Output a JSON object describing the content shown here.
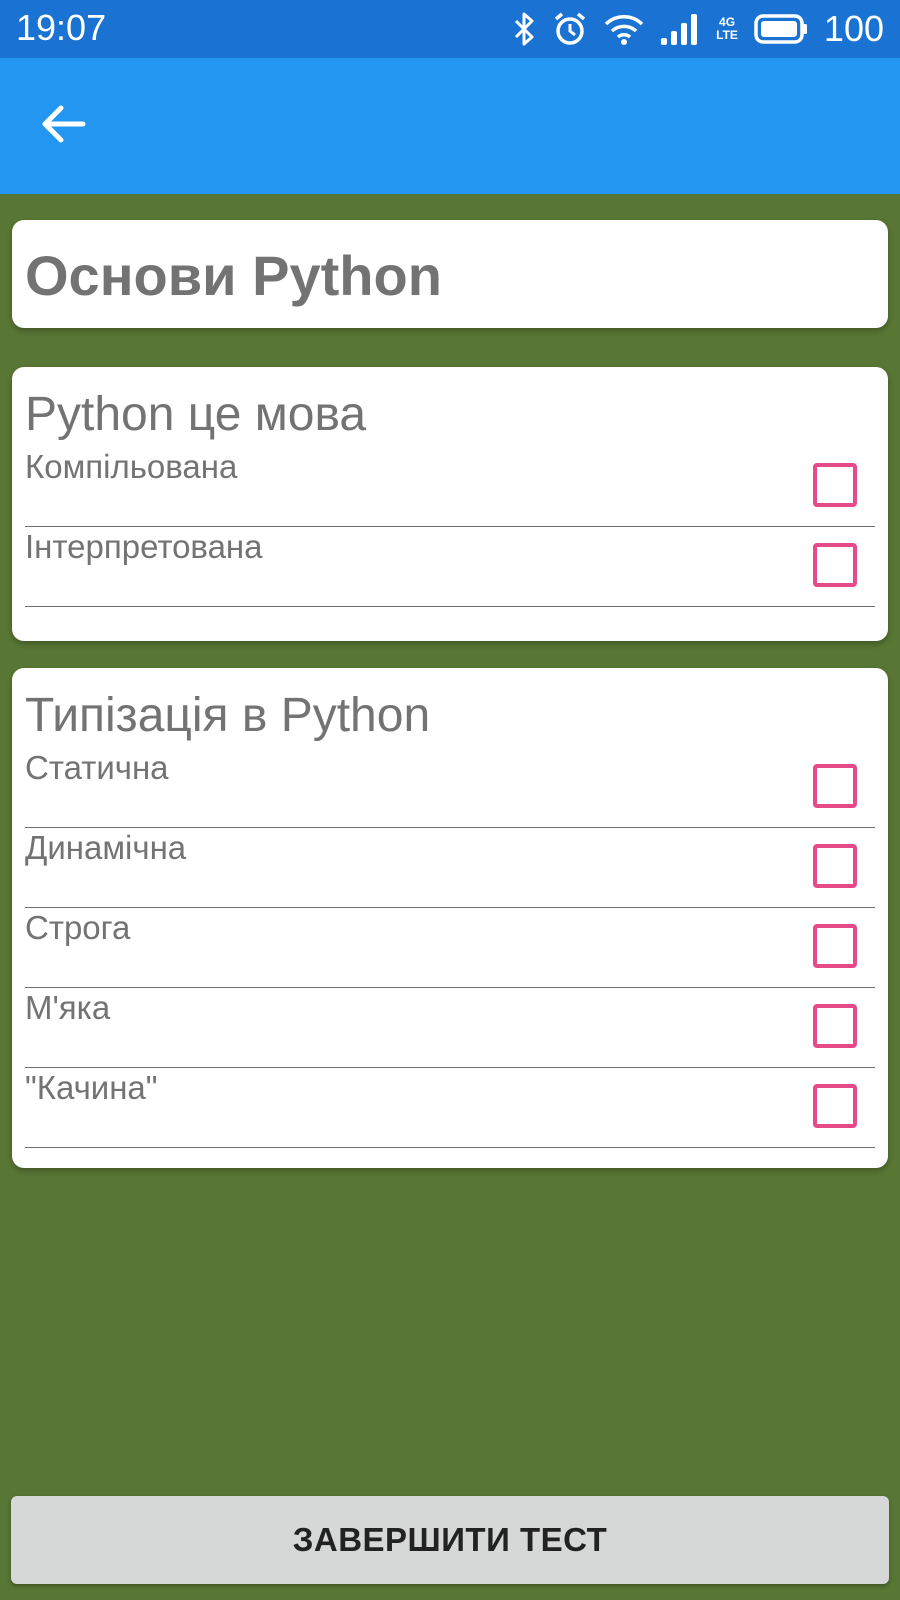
{
  "status_bar": {
    "time": "19:07",
    "network_top": "4G",
    "network_bottom": "LTE",
    "battery": "100",
    "icons": [
      "bluetooth-icon",
      "alarm-icon",
      "wifi-icon",
      "signal-icon",
      "battery-icon"
    ]
  },
  "app_bar": {
    "back_icon": "arrow-back-icon",
    "color": "#2296f1"
  },
  "test": {
    "title": "Основи Python"
  },
  "questions": [
    {
      "text": "Python це мова",
      "options": [
        "Компільована",
        "Інтерпретована"
      ]
    },
    {
      "text": "Типізація в Python",
      "options": [
        "Статична",
        "Динамічна",
        "Строга",
        "М'яка",
        "\"Качина\""
      ]
    }
  ],
  "finish_button": {
    "label": "ЗАВЕРШИТИ ТЕСТ"
  },
  "colors": {
    "background": "#587634",
    "status_bar": "#1a73d2",
    "checkbox": "#e54b88"
  }
}
